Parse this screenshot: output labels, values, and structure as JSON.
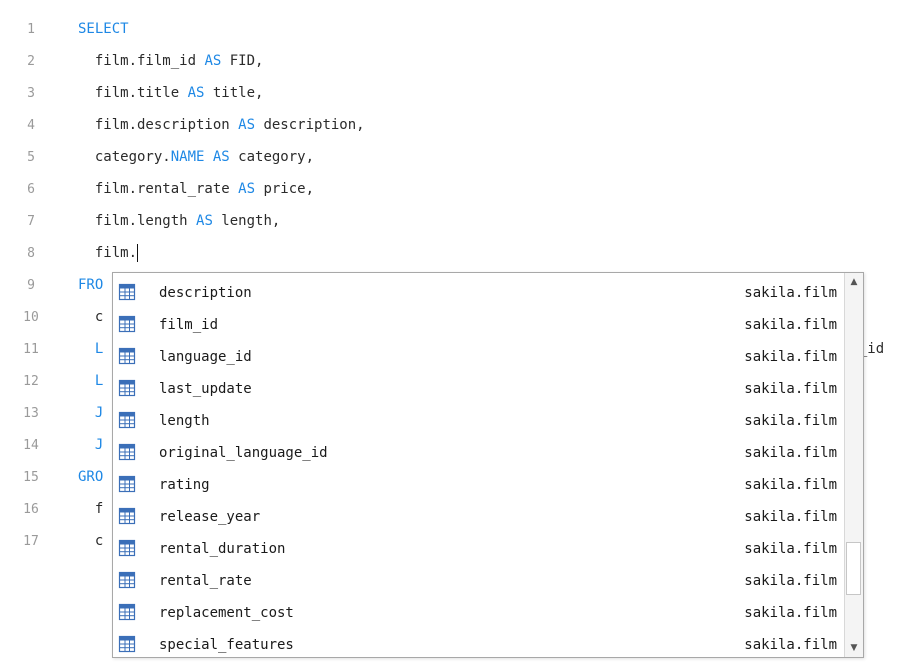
{
  "editor": {
    "lines": [
      {
        "number": "1",
        "indent": "",
        "segments": [
          {
            "text": "SELECT",
            "kw": true
          }
        ]
      },
      {
        "number": "2",
        "indent": "  ",
        "segments": [
          {
            "text": "film.film_id ",
            "kw": false
          },
          {
            "text": "AS",
            "kw": true
          },
          {
            "text": " FID,",
            "kw": false
          }
        ]
      },
      {
        "number": "3",
        "indent": "  ",
        "segments": [
          {
            "text": "film.title ",
            "kw": false
          },
          {
            "text": "AS",
            "kw": true
          },
          {
            "text": " title,",
            "kw": false
          }
        ]
      },
      {
        "number": "4",
        "indent": "  ",
        "segments": [
          {
            "text": "film.description ",
            "kw": false
          },
          {
            "text": "AS",
            "kw": true
          },
          {
            "text": " description,",
            "kw": false
          }
        ]
      },
      {
        "number": "5",
        "indent": "  ",
        "segments": [
          {
            "text": "category.",
            "kw": false
          },
          {
            "text": "NAME",
            "kw": true
          },
          {
            "text": " ",
            "kw": false
          },
          {
            "text": "AS",
            "kw": true
          },
          {
            "text": " category,",
            "kw": false
          }
        ]
      },
      {
        "number": "6",
        "indent": "  ",
        "segments": [
          {
            "text": "film.rental_rate ",
            "kw": false
          },
          {
            "text": "AS",
            "kw": true
          },
          {
            "text": " price,",
            "kw": false
          }
        ]
      },
      {
        "number": "7",
        "indent": "  ",
        "segments": [
          {
            "text": "film.length ",
            "kw": false
          },
          {
            "text": "AS",
            "kw": true
          },
          {
            "text": " length,",
            "kw": false
          }
        ]
      },
      {
        "number": "8",
        "indent": "  ",
        "segments": [
          {
            "text": "film.",
            "kw": false
          }
        ],
        "cursor": true
      },
      {
        "number": "9",
        "indent": "",
        "segments": [
          {
            "text": "FRO",
            "kw": true
          }
        ]
      },
      {
        "number": "10",
        "indent": "  ",
        "segments": [
          {
            "text": "c",
            "kw": false
          }
        ]
      },
      {
        "number": "11",
        "indent": "  ",
        "segments": [
          {
            "text": "L",
            "kw": true
          }
        ],
        "peek": "ry_id"
      },
      {
        "number": "12",
        "indent": "  ",
        "segments": [
          {
            "text": "L",
            "kw": true
          }
        ]
      },
      {
        "number": "13",
        "indent": "  ",
        "segments": [
          {
            "text": "J",
            "kw": true
          }
        ]
      },
      {
        "number": "14",
        "indent": "  ",
        "segments": [
          {
            "text": "J",
            "kw": true
          }
        ]
      },
      {
        "number": "15",
        "indent": "",
        "segments": [
          {
            "text": "GRO",
            "kw": true
          }
        ]
      },
      {
        "number": "16",
        "indent": "  ",
        "segments": [
          {
            "text": "f",
            "kw": false
          }
        ]
      },
      {
        "number": "17",
        "indent": "  ",
        "segments": [
          {
            "text": "c",
            "kw": false
          }
        ]
      }
    ]
  },
  "autocomplete": {
    "icon": "table-column-icon",
    "items": [
      {
        "name": "description",
        "source": "sakila.film"
      },
      {
        "name": "film_id",
        "source": "sakila.film"
      },
      {
        "name": "language_id",
        "source": "sakila.film"
      },
      {
        "name": "last_update",
        "source": "sakila.film"
      },
      {
        "name": "length",
        "source": "sakila.film"
      },
      {
        "name": "original_language_id",
        "source": "sakila.film"
      },
      {
        "name": "rating",
        "source": "sakila.film"
      },
      {
        "name": "release_year",
        "source": "sakila.film"
      },
      {
        "name": "rental_duration",
        "source": "sakila.film"
      },
      {
        "name": "rental_rate",
        "source": "sakila.film"
      },
      {
        "name": "replacement_cost",
        "source": "sakila.film"
      },
      {
        "name": "special_features",
        "source": "sakila.film"
      }
    ],
    "scroll": {
      "position_fraction": 0.85,
      "visible_fraction": 0.15
    }
  },
  "colors": {
    "keyword": "#1e88e5",
    "line_number": "#9a9a9a",
    "icon_blue": "#3b6fb8"
  }
}
